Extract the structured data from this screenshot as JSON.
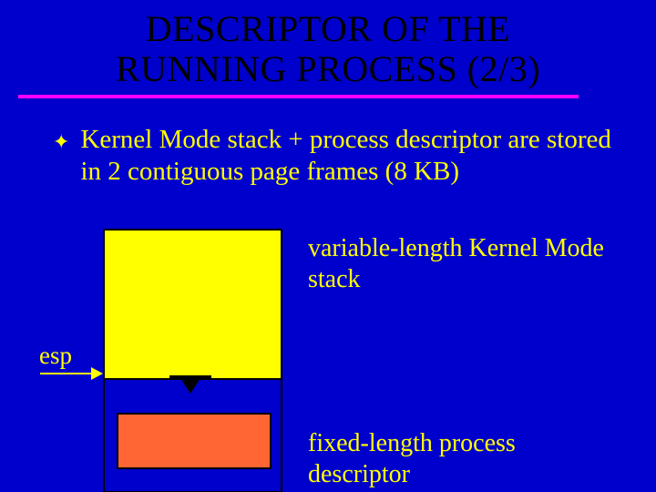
{
  "title_line1": "DESCRIPTOR OF THE",
  "title_line2": "RUNNING PROCESS (2/3)",
  "bullet": "Kernel Mode stack + process descriptor are stored in 2 contiguous page frames (8 KB)",
  "annotation_stack": "variable-length Kernel Mode stack",
  "annotation_descriptor": "fixed-length process descriptor",
  "esp_label": "esp"
}
